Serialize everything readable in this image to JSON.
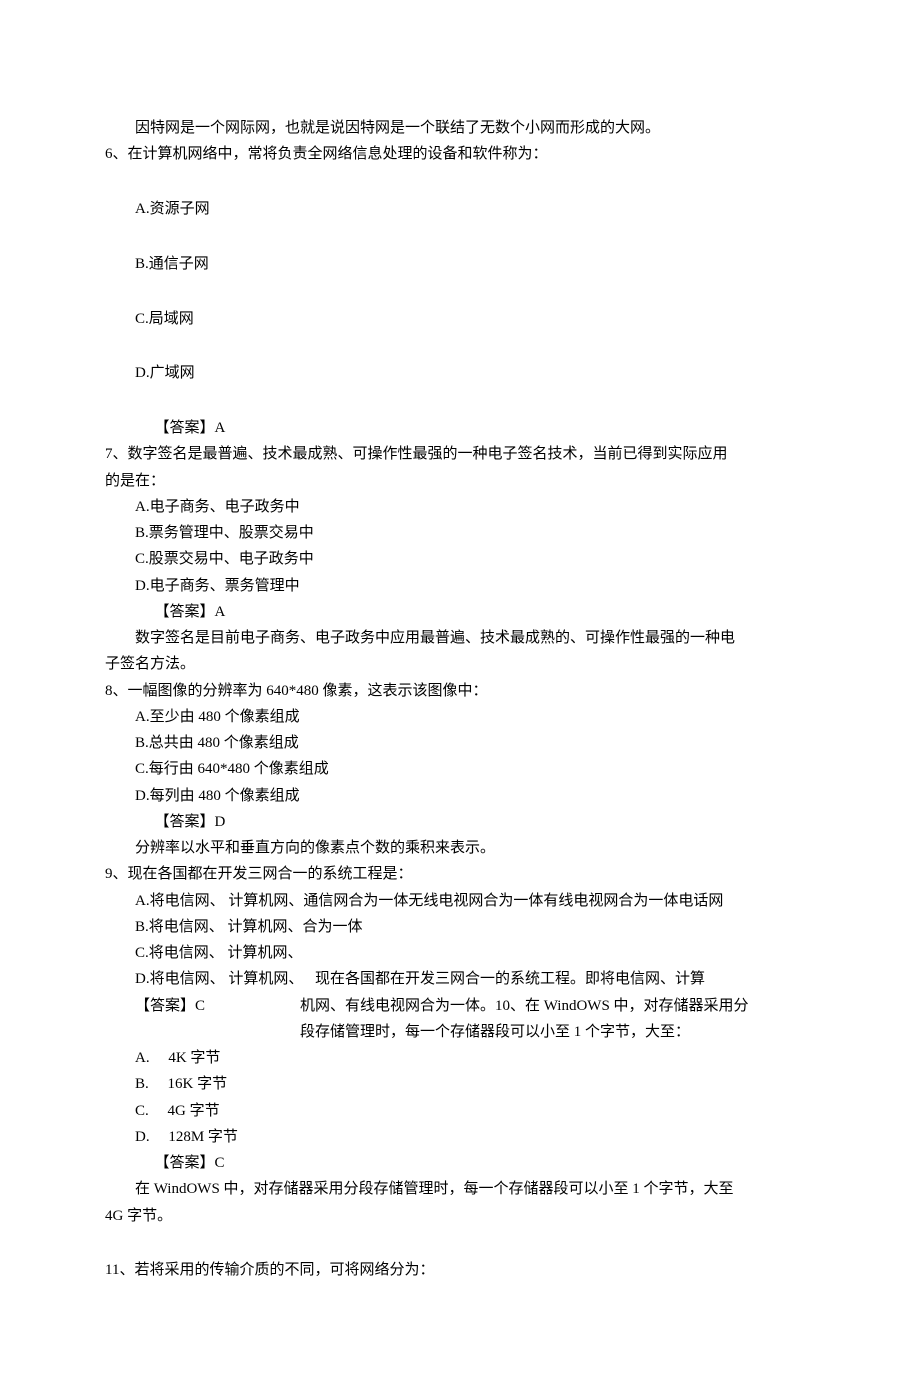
{
  "l1": "因特网是一个网际网，也就是说因特网是一个联结了无数个小网而形成的大网。",
  "q6": {
    "stem": "6、在计算机网络中，常将负责全网络信息处理的设备和软件称为：",
    "a": "A.资源子网",
    "b": "B.通信子网",
    "c": "C.局域网",
    "d": "D.广域网",
    "ans": "【答案】A"
  },
  "q7": {
    "stem1": "7、数字签名是最普遍、技术最成熟、可操作性最强的一种电子签名技术，当前已得到实际应用",
    "stem2": "的是在：",
    "a": "A.电子商务、电子政务中",
    "b": "B.票务管理中、股票交易中",
    "c": "C.股票交易中、电子政务中",
    "d": "D.电子商务、票务管理中",
    "ans": "【答案】A",
    "exp1": "数字签名是目前电子商务、电子政务中应用最普遍、技术最成熟的、可操作性最强的一种电",
    "exp2": "子签名方法。"
  },
  "q8": {
    "stem": "8、一幅图像的分辨率为 640*480 像素，这表示该图像中：",
    "a": "A.至少由 480 个像素组成",
    "b": "B.总共由 480 个像素组成",
    "c": "C.每行由 640*480 个像素组成",
    "d": "D.每列由 480 个像素组成",
    "ans": "【答案】D",
    "exp": "分辨率以水平和垂直方向的像素点个数的乘积来表示。"
  },
  "q9": {
    "stem": "9、现在各国都在开发三网合一的系统工程是：",
    "a": "A.将电信网、 计算机网、通信网合为一体无线电视网合为一体有线电视网合为一体电话网",
    "b": "B.将电信网、 计算机网、合为一体",
    "c": "C.将电信网、 计算机网、",
    "d": "D.将电信网、 计算机网、",
    "ans": "【答案】C",
    "float1": "现在各国都在开发三网合一的系统工程。即将电信网、计算",
    "float2": "机网、有线电视网合为一体。10、在 WindOWS 中，对存储器采用分",
    "float3": "段存储管理时，每一个存储器段可以小至 1 个字节，大至："
  },
  "q10": {
    "a": "A.  4K 字节",
    "b": "B.  16K 字节",
    "c": "C.  4G 字节",
    "d": "D.  128M 字节",
    "ans": "【答案】C",
    "exp1": "在 WindOWS 中，对存储器采用分段存储管理时，每一个存储器段可以小至 1 个字节，大至",
    "exp2": "4G 字节。"
  },
  "q11": {
    "stem": "11、若将采用的传输介质的不同，可将网络分为："
  }
}
